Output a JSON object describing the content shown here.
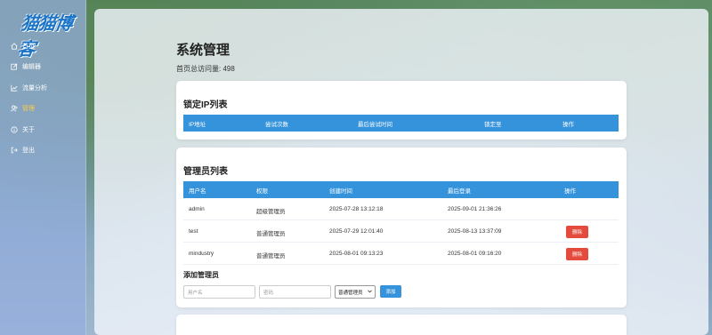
{
  "app": {
    "logo": "猫猫博客"
  },
  "sidebar": {
    "items": [
      {
        "label": "首页",
        "icon": "home-icon"
      },
      {
        "label": "编辑器",
        "icon": "edit-icon"
      },
      {
        "label": "流量分析",
        "icon": "chart-icon"
      },
      {
        "label": "管理",
        "icon": "users-icon",
        "active": true
      },
      {
        "label": "关于",
        "icon": "info-icon"
      },
      {
        "label": "登出",
        "icon": "logout-icon"
      }
    ]
  },
  "main": {
    "title": "系统管理",
    "visits": "首页总访问量: 498"
  },
  "locked_ip": {
    "title": "锁定IP列表",
    "columns": [
      "IP地址",
      "尝试次数",
      "最后尝试时间",
      "锁定至",
      "操作"
    ]
  },
  "admins": {
    "title": "管理员列表",
    "columns": [
      "用户名",
      "权限",
      "创建时间",
      "最后登录",
      "操作"
    ],
    "rows": [
      {
        "username": "admin",
        "role": "超级管理员",
        "created": "2025-07-28 13:12:18",
        "last_login": "2025-09-01 21:36:26",
        "delete": ""
      },
      {
        "username": "test",
        "role": "普通管理员",
        "created": "2025-07-29 12:01:40",
        "last_login": "2025-08-13 13:37:09",
        "delete": "删除"
      },
      {
        "username": "mindustry",
        "role": "普通管理员",
        "created": "2025-08-01 09:13:23",
        "last_login": "2025-08-01 09:16:20",
        "delete": "删除"
      }
    ]
  },
  "add_admin": {
    "title": "添加管理员",
    "username_placeholder": "用户名",
    "password_placeholder": "密码",
    "role_selected": "普通管理员",
    "add_label": "添加"
  },
  "colors": {
    "accent": "#3593db",
    "danger": "#e54b3c",
    "active_nav": "#ffcc44"
  }
}
